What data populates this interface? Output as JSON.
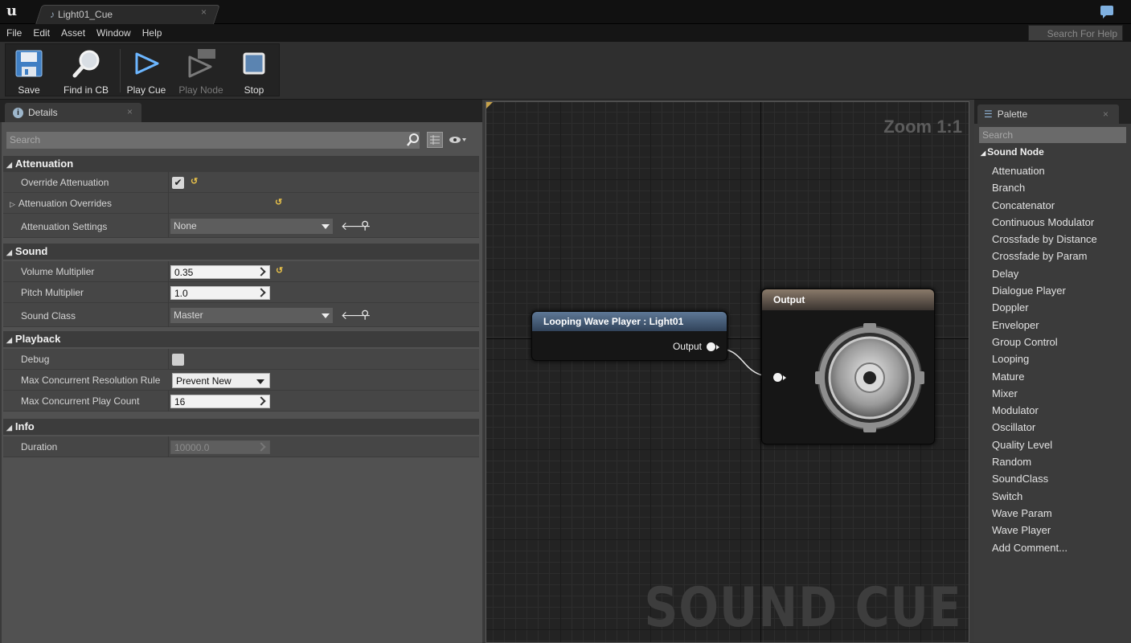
{
  "titlebar": {
    "tab_title": "Light01_Cue",
    "tab_close": "×"
  },
  "menu": [
    "File",
    "Edit",
    "Asset",
    "Window",
    "Help"
  ],
  "help_search": {
    "placeholder": "Search For Help"
  },
  "toolbar": {
    "save": "Save",
    "find_in_cb": "Find in CB",
    "play_cue": "Play Cue",
    "play_node": "Play Node",
    "stop": "Stop"
  },
  "details": {
    "tab_label": "Details",
    "tab_close": "×",
    "search_placeholder": "Search",
    "categories": {
      "attenuation": "Attenuation",
      "sound": "Sound",
      "playback": "Playback",
      "info": "Info"
    },
    "props": {
      "override_attenuation": {
        "label": "Override Attenuation",
        "checked": true
      },
      "attenuation_overrides": {
        "label": "Attenuation Overrides"
      },
      "attenuation_settings": {
        "label": "Attenuation Settings",
        "value": "None"
      },
      "volume_multiplier": {
        "label": "Volume Multiplier",
        "value": "0.35"
      },
      "pitch_multiplier": {
        "label": "Pitch Multiplier",
        "value": "1.0"
      },
      "sound_class": {
        "label": "Sound Class",
        "value": "Master"
      },
      "debug": {
        "label": "Debug",
        "checked": false
      },
      "max_concurrent_resolution_rule": {
        "label": "Max Concurrent Resolution Rule",
        "value": "Prevent New"
      },
      "max_concurrent_play_count": {
        "label": "Max Concurrent Play Count",
        "value": "16"
      },
      "duration": {
        "label": "Duration",
        "value": "10000.0"
      }
    }
  },
  "graph": {
    "zoom": "Zoom 1:1",
    "watermark": "SOUND CUE",
    "wave_node": {
      "title": "Looping Wave Player : Light01",
      "output_pin": "Output"
    },
    "output_node": {
      "title": "Output"
    }
  },
  "palette": {
    "tab_label": "Palette",
    "tab_close": "×",
    "search_placeholder": "Search",
    "category": "Sound Node",
    "items": [
      "Attenuation",
      "Branch",
      "Concatenator",
      "Continuous Modulator",
      "Crossfade by Distance",
      "Crossfade by Param",
      "Delay",
      "Dialogue Player",
      "Doppler",
      "Enveloper",
      "Group Control",
      "Looping",
      "Mature",
      "Mixer",
      "Modulator",
      "Oscillator",
      "Quality Level",
      "Random",
      "SoundClass",
      "Switch",
      "Wave Param",
      "Wave Player"
    ],
    "add_comment": "Add Comment..."
  },
  "colors": {
    "node_header_wave": "#4d6580",
    "node_header_output": "#7a6a5a",
    "reset_arrow": "#e8c14a"
  }
}
